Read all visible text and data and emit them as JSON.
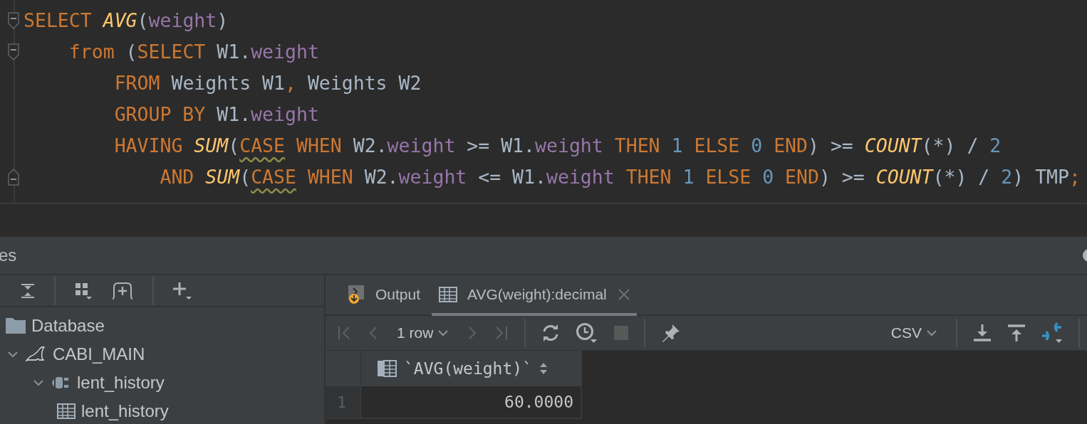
{
  "editor": {
    "lines": [
      {
        "fold_start": true,
        "fold_end": false,
        "tokens": [
          {
            "kind": "kw",
            "text": "SELECT "
          },
          {
            "kind": "fn",
            "text": "AVG"
          },
          {
            "kind": "plain",
            "text": "("
          },
          {
            "kind": "field",
            "text": "weight"
          },
          {
            "kind": "plain",
            "text": ")"
          }
        ]
      },
      {
        "fold_start": true,
        "fold_end": false,
        "tokens": [
          {
            "kind": "kw",
            "text": "    from "
          },
          {
            "kind": "plain",
            "text": "("
          },
          {
            "kind": "kw",
            "text": "SELECT "
          },
          {
            "kind": "plain",
            "text": "W1."
          },
          {
            "kind": "field",
            "text": "weight"
          }
        ]
      },
      {
        "fold_start": false,
        "fold_end": false,
        "tokens": [
          {
            "kind": "kw",
            "text": "        FROM "
          },
          {
            "kind": "plain",
            "text": "Weights W1"
          },
          {
            "kind": "kw",
            "text": ", "
          },
          {
            "kind": "plain",
            "text": "Weights W2"
          }
        ]
      },
      {
        "fold_start": false,
        "fold_end": false,
        "tokens": [
          {
            "kind": "kw",
            "text": "        GROUP BY "
          },
          {
            "kind": "plain",
            "text": "W1."
          },
          {
            "kind": "field",
            "text": "weight"
          }
        ]
      },
      {
        "fold_start": false,
        "fold_end": false,
        "tokens": [
          {
            "kind": "kw",
            "text": "        HAVING "
          },
          {
            "kind": "fn",
            "text": "SUM"
          },
          {
            "kind": "plain",
            "text": "("
          },
          {
            "kind": "warn",
            "text": "CASE"
          },
          {
            "kind": "kw",
            "text": " WHEN "
          },
          {
            "kind": "plain",
            "text": "W2."
          },
          {
            "kind": "field",
            "text": "weight"
          },
          {
            "kind": "plain",
            "text": " >= W1."
          },
          {
            "kind": "field",
            "text": "weight"
          },
          {
            "kind": "kw",
            "text": " THEN "
          },
          {
            "kind": "num",
            "text": "1"
          },
          {
            "kind": "kw",
            "text": " ELSE "
          },
          {
            "kind": "num",
            "text": "0"
          },
          {
            "kind": "kw",
            "text": " END"
          },
          {
            "kind": "plain",
            "text": ") >= "
          },
          {
            "kind": "fn",
            "text": "COUNT"
          },
          {
            "kind": "plain",
            "text": "(*) / "
          },
          {
            "kind": "num",
            "text": "2"
          }
        ]
      },
      {
        "fold_start": false,
        "fold_end": true,
        "tokens": [
          {
            "kind": "kw",
            "text": "            AND "
          },
          {
            "kind": "fn",
            "text": "SUM"
          },
          {
            "kind": "plain",
            "text": "("
          },
          {
            "kind": "warn",
            "text": "CASE"
          },
          {
            "kind": "kw",
            "text": " WHEN "
          },
          {
            "kind": "plain",
            "text": "W2."
          },
          {
            "kind": "field",
            "text": "weight"
          },
          {
            "kind": "plain",
            "text": " <= W1."
          },
          {
            "kind": "field",
            "text": "weight"
          },
          {
            "kind": "kw",
            "text": " THEN "
          },
          {
            "kind": "num",
            "text": "1"
          },
          {
            "kind": "kw",
            "text": " ELSE "
          },
          {
            "kind": "num",
            "text": "0"
          },
          {
            "kind": "kw",
            "text": " END"
          },
          {
            "kind": "plain",
            "text": ") >= "
          },
          {
            "kind": "fn",
            "text": "COUNT"
          },
          {
            "kind": "plain",
            "text": "(*) / "
          },
          {
            "kind": "num",
            "text": "2"
          },
          {
            "kind": "plain",
            "text": ") TMP"
          },
          {
            "kind": "kw",
            "text": ";"
          }
        ]
      }
    ]
  },
  "services_panel": {
    "title": "es",
    "toolbar": [
      {
        "kind": "collapse"
      },
      {
        "kind": "sep"
      },
      {
        "kind": "group"
      },
      {
        "kind": "add-session"
      },
      {
        "kind": "sep"
      },
      {
        "kind": "add"
      }
    ],
    "tree": [
      {
        "label": "Database",
        "kind": "folder"
      },
      {
        "label": "CABI_MAIN",
        "kind": "datasource",
        "expanded": true,
        "children": [
          {
            "label": "lent_history",
            "kind": "session",
            "expanded": true,
            "children": [
              {
                "label": "lent_history",
                "kind": "table"
              }
            ]
          }
        ]
      }
    ]
  },
  "results": {
    "tabs": [
      {
        "label": "Output",
        "kind": "output",
        "selected": false
      },
      {
        "label": "AVG(weight):decimal",
        "kind": "table",
        "selected": true
      }
    ],
    "toolbar": [
      {
        "kind": "first",
        "disabled": true
      },
      {
        "kind": "prev",
        "disabled": true
      },
      {
        "kind": "rows",
        "label": "1 row"
      },
      {
        "kind": "next",
        "disabled": true
      },
      {
        "kind": "last",
        "disabled": true
      },
      {
        "kind": "sep"
      },
      {
        "kind": "reload",
        "disabled": false
      },
      {
        "kind": "history",
        "disabled": false
      },
      {
        "kind": "stop",
        "disabled": true
      },
      {
        "kind": "sep"
      },
      {
        "kind": "pin",
        "disabled": false
      },
      {
        "kind": "spacer"
      },
      {
        "kind": "format",
        "label": "CSV"
      },
      {
        "kind": "sep"
      },
      {
        "kind": "download",
        "disabled": false
      },
      {
        "kind": "upload",
        "disabled": false
      },
      {
        "kind": "compare",
        "disabled": false
      },
      {
        "kind": "sep"
      }
    ],
    "grid": {
      "columns": [
        "`AVG(weight)`"
      ],
      "rows": [
        {
          "number": "1",
          "cells": [
            "60.0000"
          ]
        }
      ]
    }
  }
}
